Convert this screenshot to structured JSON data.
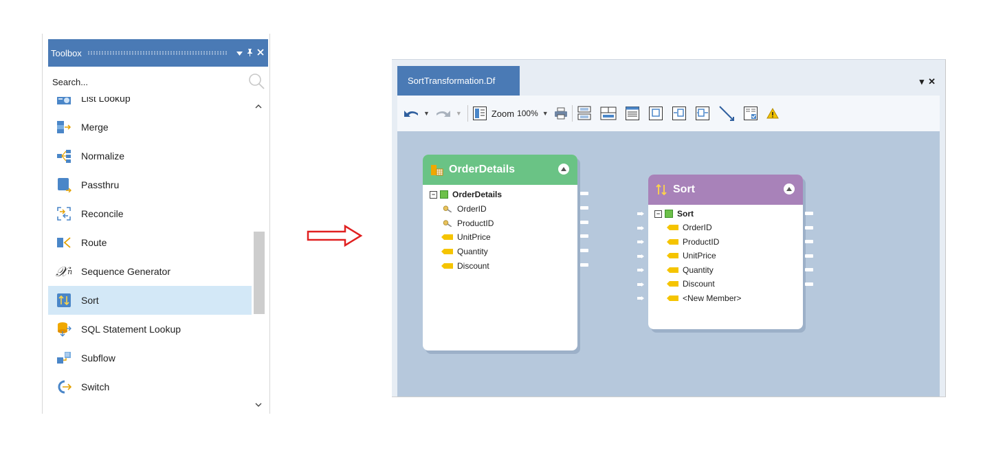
{
  "toolbox": {
    "title": "Toolbox",
    "header_buttons": [
      "▾",
      "⊥",
      "✕"
    ],
    "search_placeholder": "Search...",
    "items": [
      {
        "label": "List Lookup",
        "icon": "list-lookup-icon"
      },
      {
        "label": "Merge",
        "icon": "merge-icon"
      },
      {
        "label": "Normalize",
        "icon": "normalize-icon"
      },
      {
        "label": "Passthru",
        "icon": "passthru-icon"
      },
      {
        "label": "Reconcile",
        "icon": "reconcile-icon"
      },
      {
        "label": "Route",
        "icon": "route-icon"
      },
      {
        "label": "Sequence Generator",
        "icon": "sequence-generator-icon"
      },
      {
        "label": "Sort",
        "icon": "sort-icon",
        "selected": true
      },
      {
        "label": "SQL Statement Lookup",
        "icon": "sql-statement-lookup-icon"
      },
      {
        "label": "Subflow",
        "icon": "subflow-icon"
      },
      {
        "label": "Switch",
        "icon": "switch-icon"
      }
    ],
    "sequence_glyph": "𝒳",
    "sequence_sub": "n"
  },
  "designer": {
    "tab_title": "SortTransformation.Df",
    "window_buttons": "▾✕",
    "toolbar": {
      "zoom_label": "Zoom",
      "zoom_value": "100%",
      "icons": [
        "undo-icon",
        "redo-icon",
        "layout-icon",
        "print-icon",
        "auto-layout-icon",
        "align-icon",
        "properties-icon",
        "expand-icon",
        "input-panel-icon",
        "output-panel-icon",
        "link-icon",
        "preview-icon",
        "warning-icon"
      ]
    },
    "nodes": {
      "order_details": {
        "title": "OrderDetails",
        "color": "#6ac385",
        "root": "OrderDetails",
        "fields": [
          {
            "name": "OrderID",
            "icon": "key-icon"
          },
          {
            "name": "ProductID",
            "icon": "key-icon"
          },
          {
            "name": "UnitPrice",
            "icon": "field-icon"
          },
          {
            "name": "Quantity",
            "icon": "field-icon"
          },
          {
            "name": "Discount",
            "icon": "field-icon"
          }
        ]
      },
      "sort": {
        "title": "Sort",
        "color": "#a882b9",
        "root": "Sort",
        "fields": [
          {
            "name": "OrderID",
            "icon": "field-icon"
          },
          {
            "name": "ProductID",
            "icon": "field-icon"
          },
          {
            "name": "UnitPrice",
            "icon": "field-icon"
          },
          {
            "name": "Quantity",
            "icon": "field-icon"
          },
          {
            "name": "Discount",
            "icon": "field-icon"
          },
          {
            "name": "<New Member>",
            "icon": "field-icon"
          }
        ]
      }
    }
  },
  "colors": {
    "accent": "#4a7ab5",
    "selection": "#d3e8f7",
    "canvas": "#b6c8dc",
    "field_icon": "#f5c400",
    "arrow": "#e02020"
  }
}
